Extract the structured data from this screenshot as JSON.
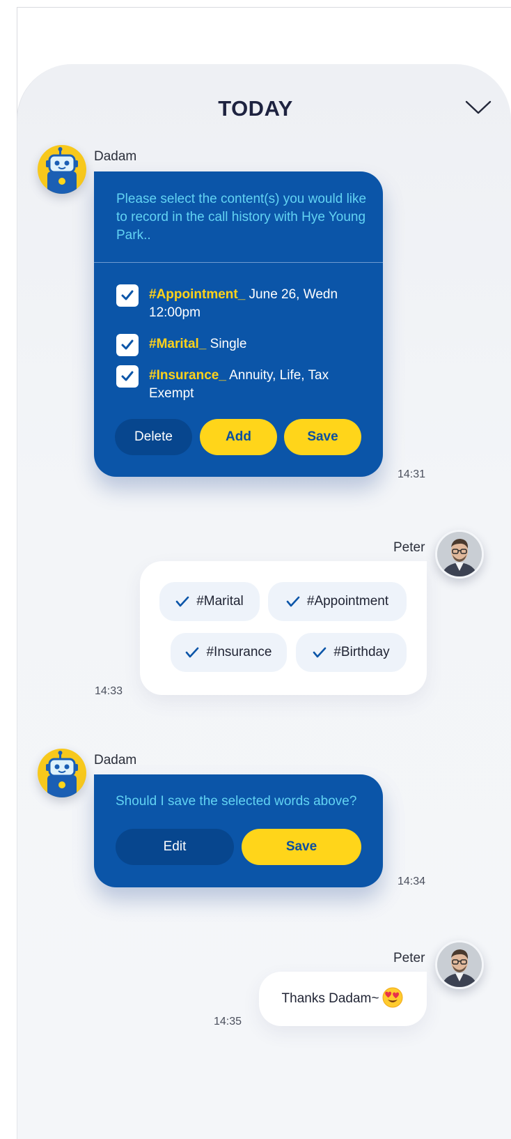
{
  "header": {
    "title": "TODAY",
    "collapse_icon": "chevron-down-icon"
  },
  "colors": {
    "bot_bubble": "#0b55a8",
    "accent_yellow": "#ffd51a",
    "bot_text": "#62d3f3"
  },
  "messages": [
    {
      "sender": "Dadam",
      "text": "Please select the content(s) you would like to record in the call history with Hye Young Park..",
      "options": [
        {
          "tag": "#Appointment_",
          "value": " June 26, Wedn 12:00pm",
          "checked": true
        },
        {
          "tag": "#Marital_",
          "value": " Single",
          "checked": true
        },
        {
          "tag": "#Insurance_",
          "value": " Annuity, Life, Tax Exempt",
          "checked": true
        }
      ],
      "buttons": {
        "delete": "Delete",
        "add": "Add",
        "save": "Save"
      },
      "time": "14:31"
    },
    {
      "sender": "Peter",
      "chips": [
        "#Marital",
        "#Appointment",
        "#Insurance",
        "#Birthday"
      ],
      "time": "14:33"
    },
    {
      "sender": "Dadam",
      "text": "Should I save the selected words above?",
      "buttons": {
        "edit": "Edit",
        "save": "Save"
      },
      "time": "14:34"
    },
    {
      "sender": "Peter",
      "text": "Thanks Dadam~",
      "emoji": "smiling-face-with-heart-eyes-icon",
      "time": "14:35"
    }
  ]
}
